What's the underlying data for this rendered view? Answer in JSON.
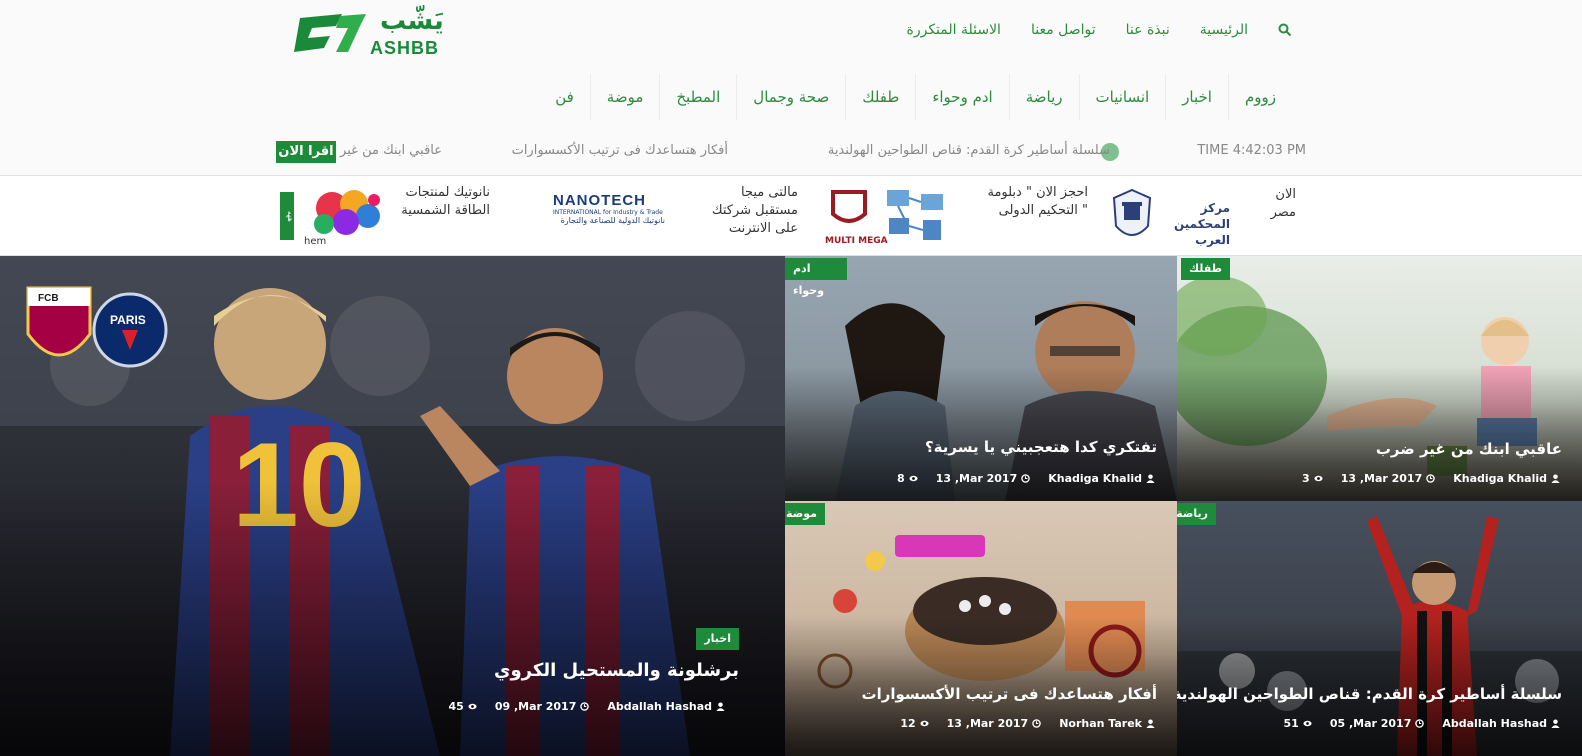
{
  "logo": {
    "arabic": "يَشّب",
    "latin": "ASHBB"
  },
  "topnav": [
    "الرئيسية",
    "نبذة عنا",
    "تواصل معنا",
    "الاسئلة المتكررة"
  ],
  "categories": [
    "زووم",
    "اخبار",
    "انسانيات",
    "رياضة",
    "ادم وحواء",
    "طفلك",
    "صحة وجمال",
    "المطبخ",
    "موضة",
    "فن"
  ],
  "ticker": {
    "time": "TIME 4:42:03 PM",
    "items": [
      "سلسلة أساطير كرة القدم: قناص الطواحين الهولندية",
      "أفكار هتساعدك فى ترتيب الأكسسوارات",
      "عاقبي ابنك من غير"
    ],
    "button": "اقرا الان"
  },
  "ads": {
    "a1": "الان\nمصر",
    "a2_logo": "مركز المحكمين العرب",
    "a3": "احجز الان \" دبلومة\n\" التحكيم الدولى",
    "a4_logo": "MULTI MEGA",
    "a5": "مالتى ميجا\nمستقبل شركتك\nعلى الانترنت",
    "a6_logo_main": "NANOTECH",
    "a6_logo_sub": "INTERNATIONAL for Industry & Trade",
    "a6_logo_ar": "نانوتيك الدولية للصناعة والتجارة",
    "a7": "نانوتيك لمنتجات\nالطاقة الشمسية",
    "a8_logo": "hem",
    "a8_side": "ههه"
  },
  "cards": {
    "main": {
      "badge": "اخبار",
      "title": "برشلونة والمستحيل الكروي",
      "author": "Abdallah Hashad",
      "date": "09 ,Mar 2017",
      "views": "45",
      "crest_left": "FCB",
      "crest_right": "PARIS"
    },
    "c1": {
      "badge": "طفلك",
      "title": "عاقبي ابنك من غير ضرب",
      "author": "Khadiga Khalid",
      "date": "13 ,Mar 2017",
      "views": "3"
    },
    "c2": {
      "badge": "ادم وحواء",
      "title": "تفتكري كدا هتعجبيني يا يسرية؟",
      "author": "Khadiga Khalid",
      "date": "13 ,Mar 2017",
      "views": "8"
    },
    "c3": {
      "badge": "رياضة",
      "title": "سلسلة أساطير كرة القدم: قناص الطواحين الهولندية",
      "author": "Abdallah Hashad",
      "date": "05 ,Mar 2017",
      "views": "51"
    },
    "c4": {
      "badge": "موضة",
      "title": "أفكار هتساعدك فى ترتيب الأكسسوارات",
      "author": "Norhan Tarek",
      "date": "13 ,Mar 2017",
      "views": "12"
    }
  },
  "colors": {
    "accent": "#1e8b3a",
    "link": "#2e8b3e"
  }
}
